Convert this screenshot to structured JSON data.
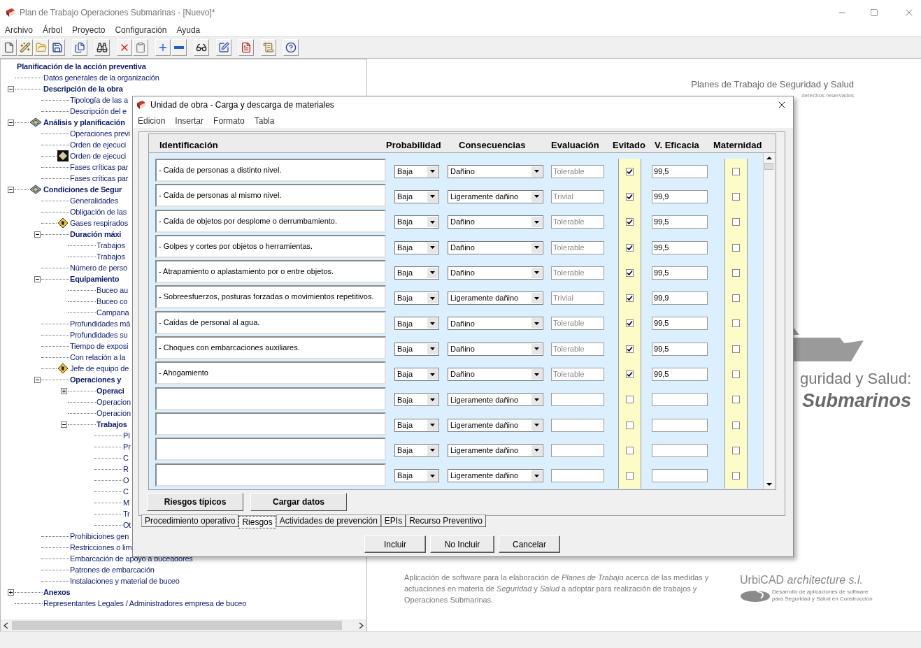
{
  "window": {
    "title": "Plan de Trabajo Operaciones Submarinas - [Nuevo]*"
  },
  "menu": [
    "Archivo",
    "Árbol",
    "Proyecto",
    "Configuración",
    "Ayuda"
  ],
  "tree": [
    {
      "label": "Planificación de la acción preventiva",
      "kind": "folder",
      "children": [
        {
          "label": "Datos generales de la organización",
          "kind": "page"
        },
        {
          "label": "Descripción de la obra",
          "kind": "folder",
          "expanded": true,
          "children": [
            {
              "label": "Tipología de las a",
              "kind": "page"
            },
            {
              "label": "Descripción del e",
              "kind": "page"
            }
          ]
        },
        {
          "label": "Análisis y planificación",
          "kind": "section",
          "expanded": true,
          "children": [
            {
              "label": "Operaciones previ",
              "kind": "page"
            },
            {
              "label": "Orden de ejecuci",
              "kind": "page"
            },
            {
              "label": "Orden de ejecuci",
              "kind": "flagged"
            },
            {
              "label": "Fases críticas par",
              "kind": "page"
            },
            {
              "label": "Fases críticas par",
              "kind": "page"
            }
          ]
        },
        {
          "label": "Condiciones de Segur",
          "kind": "section",
          "expanded": true,
          "children": [
            {
              "label": "Generalidades",
              "kind": "page"
            },
            {
              "label": "Obligación de las",
              "kind": "page"
            },
            {
              "label": "Gases respirados",
              "kind": "task"
            },
            {
              "label": "Duración máxi",
              "kind": "folder",
              "expanded": true,
              "children": [
                {
                  "label": "Trabajos",
                  "kind": "page"
                },
                {
                  "label": "Trabajos",
                  "kind": "page"
                }
              ]
            },
            {
              "label": "Número de perso",
              "kind": "page"
            },
            {
              "label": "Equipamiento",
              "kind": "folder",
              "expanded": true,
              "children": [
                {
                  "label": "Buceo au",
                  "kind": "page"
                },
                {
                  "label": "Buceo co",
                  "kind": "page"
                },
                {
                  "label": "Campana",
                  "kind": "page"
                }
              ]
            },
            {
              "label": "Profundidades má",
              "kind": "page"
            },
            {
              "label": "Profundidades su",
              "kind": "page"
            },
            {
              "label": "Tiempo de exposi",
              "kind": "page"
            },
            {
              "label": "Con relación a la",
              "kind": "page"
            },
            {
              "label": "Jefe de equipo de",
              "kind": "task"
            },
            {
              "label": "Operaciones y",
              "kind": "folder",
              "expanded": true,
              "children": [
                {
                  "label": "Operaci",
                  "kind": "folder",
                  "expanded": false
                },
                {
                  "label": "Operacion",
                  "kind": "page"
                },
                {
                  "label": "Operacion",
                  "kind": "page"
                },
                {
                  "label": "Trabajos",
                  "kind": "folder",
                  "expanded": true,
                  "children": [
                    {
                      "label": "Pl",
                      "kind": "page"
                    },
                    {
                      "label": "Pr",
                      "kind": "page"
                    },
                    {
                      "label": "C",
                      "kind": "page"
                    },
                    {
                      "label": "R",
                      "kind": "page"
                    },
                    {
                      "label": "O",
                      "kind": "page"
                    },
                    {
                      "label": "C",
                      "kind": "page"
                    },
                    {
                      "label": "M",
                      "kind": "page"
                    },
                    {
                      "label": "Tr",
                      "kind": "page"
                    },
                    {
                      "label": "Ot",
                      "kind": "page"
                    }
                  ]
                }
              ]
            },
            {
              "label": "Prohibiciones gen",
              "kind": "page"
            },
            {
              "label": "Restricciones o lim",
              "kind": "page"
            },
            {
              "label": "Embarcación de apoyo a buceadores",
              "kind": "page"
            },
            {
              "label": "Patrones de embarcación",
              "kind": "page"
            },
            {
              "label": "Instalaciones y material de buceo",
              "kind": "page"
            }
          ]
        },
        {
          "label": "Anexos",
          "kind": "folder",
          "expanded": false
        },
        {
          "label": "Representantes Legales / Administradores empresa de buceo",
          "kind": "page"
        }
      ]
    }
  ],
  "splash": {
    "heading": "Planes de Trabajo de Seguridad y Salud",
    "rights": "derechos reservados",
    "title_line": "guridad y Salud:",
    "title_emphasis": "Submarinos",
    "description": "Aplicación de software para la elaboración de *Planes de Trabajo* acerca de las medidas y actuaciones en materia de *Seguridad* y *Salud* a adoptar para realización de trabajos y Operaciones Submarinas.",
    "company": "UrbiCAD *architecture s.l.*",
    "company_tagline": "Desarrollo de aplicaciones de software para Seguridad y Salud en Construcción"
  },
  "dialog": {
    "title": "Unidad de obra - Carga y descarga de materiales",
    "menu": [
      "Edicion",
      "Insertar",
      "Formato",
      "Tabla"
    ],
    "columns": [
      "Identificación",
      "Probabilidad",
      "Consecuencias",
      "Evaluación",
      "Evitado",
      "V. Eficacia",
      "Maternidad"
    ],
    "rows": [
      {
        "identification": "- Caída de personas a distinto nivel.",
        "probability": "Baja",
        "consequence": "Dañino",
        "evaluation": "Tolerable",
        "evitado": true,
        "efficacy": "99,5",
        "maternidad": false
      },
      {
        "identification": "- Caída de personas al mismo nivel.",
        "probability": "Baja",
        "consequence": "Ligeramente dañino",
        "evaluation": "Trivial",
        "evitado": true,
        "efficacy": "99,9",
        "maternidad": false
      },
      {
        "identification": "- Caída de objetos por desplome o derrumbamiento.",
        "probability": "Baja",
        "consequence": "Dañino",
        "evaluation": "Tolerable",
        "evitado": true,
        "efficacy": "99,5",
        "maternidad": false
      },
      {
        "identification": "- Golpes y cortes por objetos o herramientas.",
        "probability": "Baja",
        "consequence": "Dañino",
        "evaluation": "Tolerable",
        "evitado": true,
        "efficacy": "99,5",
        "maternidad": false
      },
      {
        "identification": "- Atrapamiento o aplastamiento por o entre objetos.",
        "probability": "Baja",
        "consequence": "Dañino",
        "evaluation": "Tolerable",
        "evitado": true,
        "efficacy": "99,5",
        "maternidad": false
      },
      {
        "identification": "- Sobreesfuerzos, posturas forzadas o movimientos repetitivos.",
        "probability": "Baja",
        "consequence": "Ligeramente dañino",
        "evaluation": "Trivial",
        "evitado": true,
        "efficacy": "99,9",
        "maternidad": false
      },
      {
        "identification": "- Caídas de personal al agua.",
        "probability": "Baja",
        "consequence": "Dañino",
        "evaluation": "Tolerable",
        "evitado": true,
        "efficacy": "99,5",
        "maternidad": false
      },
      {
        "identification": "- Choques con embarcaciones auxiliares.",
        "probability": "Baja",
        "consequence": "Dañino",
        "evaluation": "Tolerable",
        "evitado": true,
        "efficacy": "99,5",
        "maternidad": false
      },
      {
        "identification": "- Ahogamiento",
        "probability": "Baja",
        "consequence": "Dañino",
        "evaluation": "Tolerable",
        "evitado": true,
        "efficacy": "99,5",
        "maternidad": false
      },
      {
        "probability": "Baja",
        "consequence": "Ligeramente dañino",
        "evitado": false,
        "maternidad": false
      },
      {
        "probability": "Baja",
        "consequence": "Ligeramente dañino",
        "evitado": false,
        "maternidad": false
      },
      {
        "probability": "Baja",
        "consequence": "Ligeramente dañino",
        "evitado": false,
        "maternidad": false
      },
      {
        "probability": "Baja",
        "consequence": "Ligeramente dañino",
        "evitado": false,
        "maternidad": false
      }
    ],
    "actions": [
      "Riesgos típicos",
      "Cargar datos"
    ],
    "tabs": [
      {
        "label": "Procedimiento operativo",
        "selected": false
      },
      {
        "label": "Riesgos",
        "selected": true
      },
      {
        "label": "Actividades de prevención",
        "selected": false
      },
      {
        "label": "EPIs",
        "selected": false
      },
      {
        "label": "Recurso Preventivo",
        "selected": false
      }
    ],
    "buttons": [
      "Incluir",
      "No Incluir",
      "Cancelar"
    ]
  }
}
